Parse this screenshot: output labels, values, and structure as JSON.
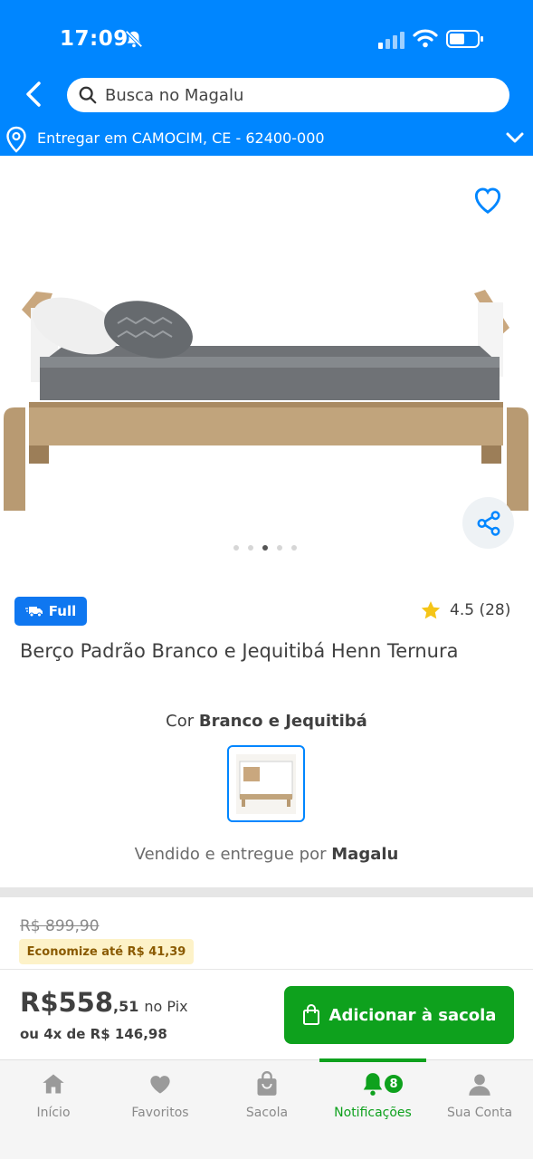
{
  "status_bar": {
    "time": "17:09"
  },
  "header": {
    "search_placeholder": "Busca no Magalu",
    "delivery_text": "Entregar em CAMOCIM, CE - 62400-000"
  },
  "gallery": {
    "image_count": 5,
    "active_index": 2
  },
  "product": {
    "badge": "Full",
    "rating": "4.5 (28)",
    "title": "Berço Padrão Branco e Jequitibá Henn Ternura",
    "color_label": "Cor",
    "color_value": "Branco e Jequitibá",
    "sold_by_label": "Vendido e entregue por",
    "sold_by_value": "Magalu"
  },
  "pricing": {
    "old_price": "R$ 899,90",
    "savings": "Economize até R$ 41,39",
    "price_main": "R$558",
    "price_cents": ",51",
    "price_suffix": "no Pix",
    "installments": "ou 4x de R$ 146,98",
    "add_to_cart": "Adicionar à sacola"
  },
  "tabs": [
    {
      "label": "Início",
      "icon": "home-icon"
    },
    {
      "label": "Favoritos",
      "icon": "heart-icon"
    },
    {
      "label": "Sacola",
      "icon": "bag-icon"
    },
    {
      "label": "Notificações",
      "icon": "bell-icon",
      "badge": "8",
      "active": true
    },
    {
      "label": "Sua Conta",
      "icon": "user-icon"
    }
  ],
  "colors": {
    "brand_blue": "#0086ff",
    "green": "#0ea11d",
    "badge_blue": "#0f77f0"
  }
}
